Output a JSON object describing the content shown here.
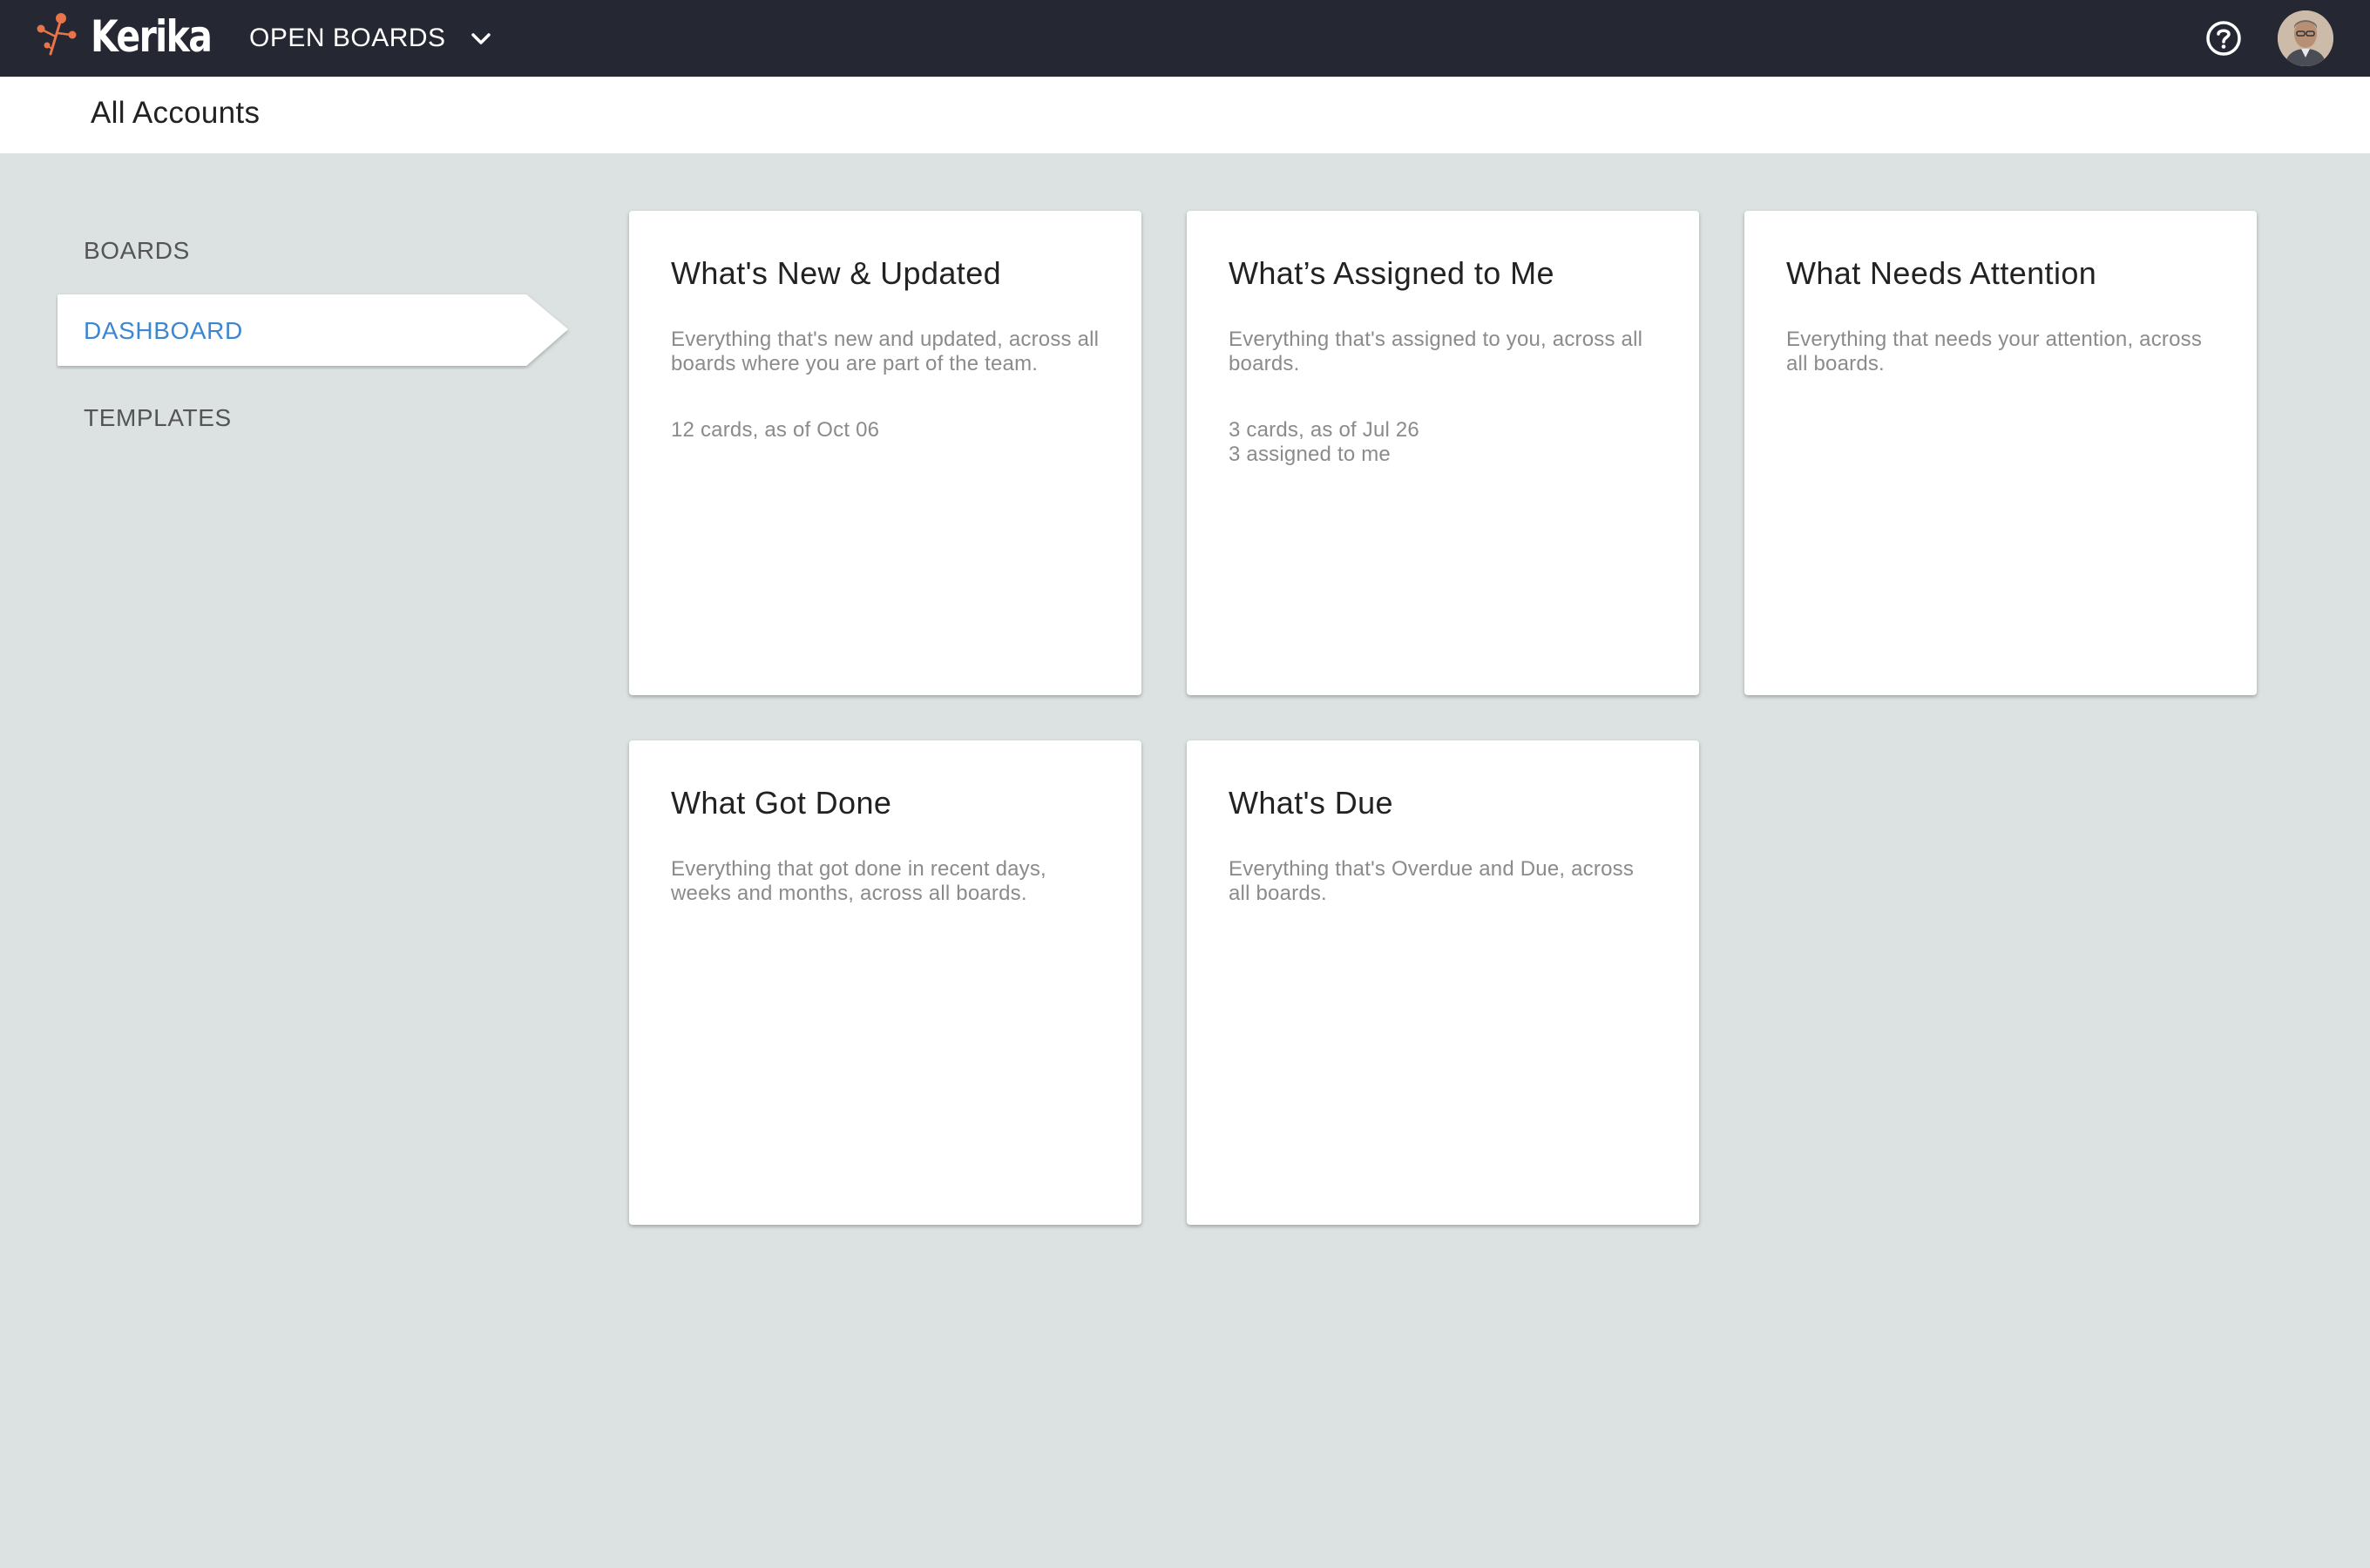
{
  "app": {
    "logo_text": "Kerika",
    "board_menu_label": "OPEN BOARDS"
  },
  "subheader": {
    "title": "All Accounts"
  },
  "sidebar": {
    "items": [
      {
        "label": "BOARDS",
        "active": false
      },
      {
        "label": "DASHBOARD",
        "active": true
      },
      {
        "label": "TEMPLATES",
        "active": false
      }
    ]
  },
  "cards": [
    {
      "title": "What's New & Updated",
      "description": "Everything that's new and updated, across all boards where you are part of the team.",
      "meta": [
        "12 cards, as of Oct 06"
      ]
    },
    {
      "title": "What’s Assigned to Me",
      "description": "Everything that's assigned to you, across all boards.",
      "meta": [
        "3 cards, as of Jul 26",
        "3 assigned to me"
      ]
    },
    {
      "title": "What Needs Attention",
      "description": "Everything that needs your attention, across all boards.",
      "meta": []
    },
    {
      "title": "What Got Done",
      "description": "Everything that got done in recent days, weeks and months, across all boards.",
      "meta": []
    },
    {
      "title": "What's Due",
      "description": "Everything that's Overdue and Due, across all boards.",
      "meta": []
    }
  ],
  "icons": {
    "logo": "kerika-flower-logo-icon",
    "board_menu": "chevron-down-icon",
    "help": "help-circle-icon",
    "avatar": "user-avatar"
  },
  "colors": {
    "topbar": "#252832",
    "background": "#dbe2e1",
    "accent": "#3d86d0",
    "logo_orange": "#e8744a"
  }
}
